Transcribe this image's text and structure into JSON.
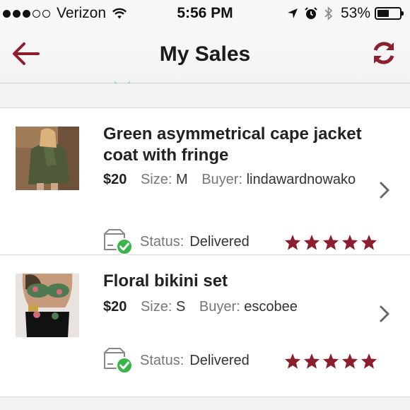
{
  "status_bar": {
    "carrier": "Verizon",
    "time": "5:56 PM",
    "battery": "53%",
    "battery_level": 0.53
  },
  "nav": {
    "title": "My Sales",
    "back_icon": "back-arrow-icon",
    "refresh_icon": "refresh-icon"
  },
  "colors": {
    "accent": "#8c1f2d",
    "star": "#8c1f2d",
    "check": "#39b54a"
  },
  "sales": [
    {
      "title": "Green asymmetrical cape jacket coat with fringe",
      "price": "$20",
      "size_label": "Size:",
      "size": "M",
      "buyer_label": "Buyer:",
      "buyer": "lindawardnowako",
      "status_label": "Status:",
      "status": "Delivered",
      "rating": 5
    },
    {
      "title": "Floral bikini set",
      "price": "$20",
      "size_label": "Size:",
      "size": "S",
      "buyer_label": "Buyer:",
      "buyer": "escobee",
      "status_label": "Status:",
      "status": "Delivered",
      "rating": 5
    }
  ]
}
